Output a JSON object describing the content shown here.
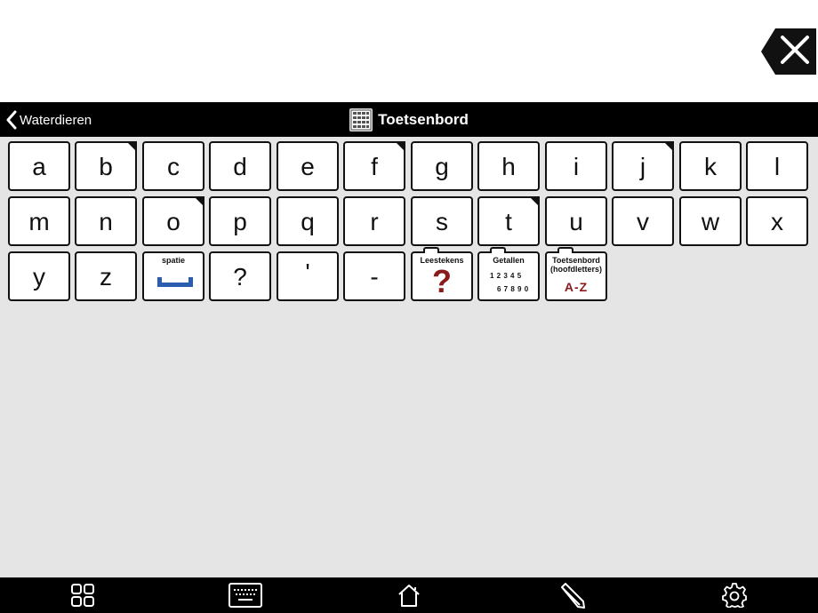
{
  "header": {
    "back_label": "Waterdieren",
    "title": "Toetsenbord"
  },
  "keys": {
    "row1": [
      "a",
      "b",
      "c",
      "d",
      "e",
      "f",
      "g",
      "h",
      "i",
      "j",
      "k",
      "l"
    ],
    "row2": [
      "m",
      "n",
      "o",
      "p",
      "q",
      "r",
      "s",
      "t",
      "u",
      "v",
      "w",
      "x"
    ],
    "row3": [
      "y",
      "z",
      "?",
      "'",
      "-"
    ],
    "space_label": "spatie",
    "punctuation_label": "Leestekens",
    "punctuation_symbol": "?",
    "numbers_label": "Getallen",
    "numbers_line1": "1 2 3 4 5",
    "numbers_line2": "6 7 8 9 0",
    "uppercase_label_line1": "Toetsenbord",
    "uppercase_label_line2": "(hoofdletters)",
    "uppercase_symbol": "A-Z"
  },
  "colors": {
    "accent_red": "#8b1a1a",
    "space_blue": "#2a5db0",
    "background": "#e5e5e5"
  },
  "icons": {
    "clear": "close-icon",
    "back": "chevron-left-icon",
    "title": "keyboard-grid-icon",
    "toolbar": [
      "grid-icon",
      "keyboard-icon",
      "home-icon",
      "pencil-icon",
      "gear-icon"
    ]
  }
}
